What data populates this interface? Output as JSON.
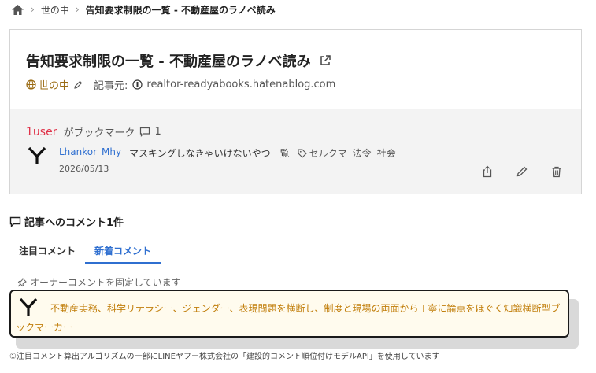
{
  "breadcrumb": {
    "items": [
      "世の中",
      "告知要求制限の一覧 - 不動産屋のラノベ読み"
    ]
  },
  "entry": {
    "title": "告知要求制限の一覧 - 不動産屋のラノベ読み",
    "category": "世の中",
    "source_label": "記事元:",
    "source": "realtor-readyabooks.hatenablog.com"
  },
  "stats": {
    "users": "1user",
    "bookmark_label": "がブックマーク",
    "comment_count": "1"
  },
  "bookmark": {
    "user": "Lhankor_Mhy",
    "comment": "マスキングしなきゃいけないやつ一覧",
    "tags": [
      "セルクマ",
      "法令",
      "社会"
    ],
    "date": "2026/05/13"
  },
  "comments": {
    "heading": "記事へのコメント1件",
    "tabs": [
      "注目コメント",
      "新着コメント"
    ],
    "pinned_notice": "オーナーコメントを固定しています",
    "owner_comment": "不動産実務、科学リテラシー、ジェンダー、表現問題を横断し、制度と現場の両面から丁寧に論点をほぐく知識横断型ブックマーカー",
    "footnote": "①注目コメント算出アルゴリズムの一部にLINEヤフー株式会社の「建設的コメント順位付けモデルAPI」を使用しています"
  },
  "colors": {
    "accent": "#2f6fd0",
    "users": "#e0334a",
    "owner_text": "#c17e0b"
  }
}
